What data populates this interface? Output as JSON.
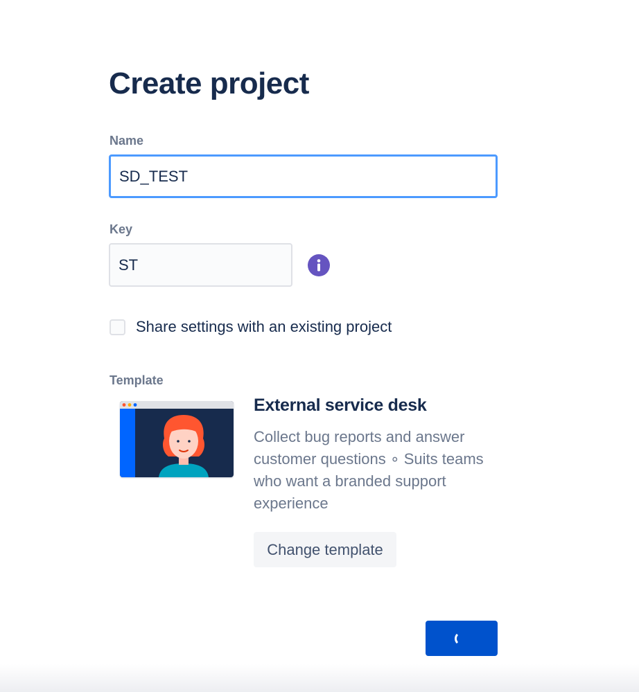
{
  "page": {
    "title": "Create project"
  },
  "form": {
    "name_label": "Name",
    "name_value": "SD_TEST",
    "key_label": "Key",
    "key_value": "ST",
    "share_settings_label": "Share settings with an existing project",
    "share_settings_checked": false
  },
  "template": {
    "section_label": "Template",
    "title": "External service desk",
    "description": "Collect bug reports and answer customer questions ∘ Suits teams who want a branded support experience",
    "change_button_label": "Change template"
  },
  "submit": {
    "state": "loading"
  },
  "colors": {
    "focus_border": "#4c9aff",
    "primary_button": "#0052cc",
    "info_icon": "#6554c0",
    "heading": "#172b4d",
    "subtle_text": "#6b778c"
  }
}
